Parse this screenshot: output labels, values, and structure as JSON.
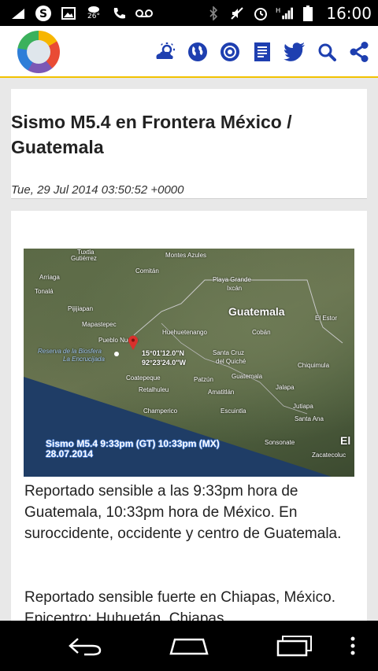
{
  "status_bar": {
    "temperature": "26°",
    "time": "16:00"
  },
  "header": {
    "icons": [
      "weather-icon",
      "globe-icon",
      "radar-icon",
      "article-icon",
      "twitter-icon",
      "search-icon",
      "share-icon"
    ]
  },
  "post": {
    "title": "Sismo M5.4 en Frontera México / Guatemala",
    "date": "Tue, 29 Jul 2014 03:50:52 +0000",
    "map": {
      "caption_line1": "Sismo M5.4 9:33pm (GT) 10:33pm (MX)",
      "caption_line2": "28.07.2014",
      "coord_lat": "15°01'12.0\"N",
      "coord_lon": "92°23'24.0\"W",
      "labels": {
        "guatemala_region": "Guatemala",
        "montes_azules": "Montes Azules",
        "tuxtla": "Tuxtla",
        "gutierrez": "Gutiérrez",
        "comitan": "Comitán",
        "playa_grande": "Playa Grande",
        "ixcan": "Ixcán",
        "arriaga": "Arriaga",
        "tonala": "Tonalá",
        "pijijiapan": "Pijijiapan",
        "mapastepec": "Mapastepec",
        "huehuetenango": "Huehuetenango",
        "coban": "Cobán",
        "el_estor": "El Estor",
        "pueblo_nuevo": "Pueblo Nuevo",
        "reserva": "Reserva de la Biosfera",
        "encrucijada": "La Encrucijada",
        "santa_cruz": "Santa Cruz",
        "quiche": "del Quiché",
        "chiquimula": "Chiquimula",
        "coatepeque": "Coatepeque",
        "patzun": "Patzún",
        "guatemala_city": "Guatemala",
        "retalhuleu": "Retalhuleu",
        "amatitlan": "Amatitlán",
        "jalapa": "Jalapa",
        "jutiapa": "Jutiapa",
        "champerico": "Champerico",
        "escuintla": "Escuintla",
        "santa_ana": "Santa Ana",
        "sonsonate": "Sonsonate",
        "el": "El",
        "zacatecoluca": "Zacatecoluc"
      }
    },
    "paragraph1": "Reportado sensible a las 9:33pm hora de Guatemala, 10:33pm hora de México. En suroccidente, occidente y centro de Guatemala.",
    "paragraph2": "Reportado sensible fuerte en Chiapas, México. Epicentro: Huhuetán, Chiapas."
  },
  "colors": {
    "accent": "#1e3fb0",
    "header_border": "#f2c200"
  }
}
